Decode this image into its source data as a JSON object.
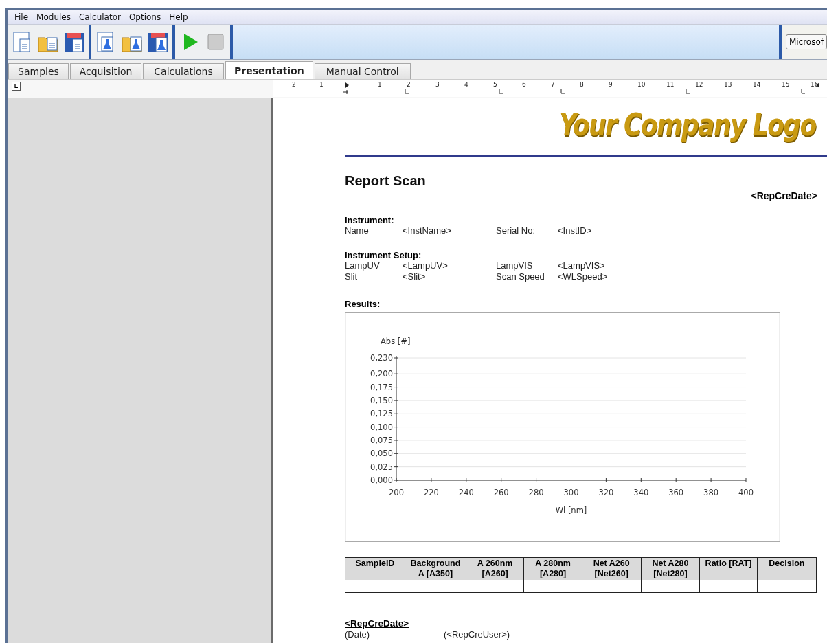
{
  "menu": [
    "File",
    "Modules",
    "Calculator",
    "Options",
    "Help"
  ],
  "toolbar": {
    "groups": [
      [
        {
          "kind": "doc"
        },
        {
          "kind": "folder-doc"
        },
        {
          "kind": "floppy-doc"
        }
      ],
      [
        {
          "kind": "flask-doc"
        },
        {
          "kind": "folder-flask"
        },
        {
          "kind": "floppy-flask"
        }
      ],
      [
        {
          "kind": "play"
        },
        {
          "kind": "stop"
        }
      ]
    ],
    "font_box": "Microsof"
  },
  "tabs": [
    {
      "label": "Samples",
      "selected": false
    },
    {
      "label": "Acquisition",
      "selected": false
    },
    {
      "label": "Calculations",
      "selected": false
    },
    {
      "label": "Presentation",
      "selected": true
    },
    {
      "label": "Manual Control",
      "selected": false
    }
  ],
  "ruler": {
    "corner": "L",
    "labels": [
      "2",
      "1",
      "1",
      "2",
      "3",
      "4",
      "5",
      "6",
      "7",
      "8",
      "9",
      "10",
      "11",
      "12",
      "13",
      "14",
      "15",
      "16"
    ]
  },
  "report": {
    "logo": "Your Company Logo",
    "title": "Report Scan",
    "date": "<RepCreDate>",
    "instrument": {
      "heading": "Instrument:",
      "fields": [
        {
          "label": "Name",
          "value": "<InstName>"
        },
        {
          "label": "Serial No:",
          "value": "<InstID>"
        }
      ]
    },
    "setup": {
      "heading": "Instrument Setup:",
      "fields": [
        {
          "label": "LampUV",
          "value": "<LampUV>"
        },
        {
          "label": "LampVIS",
          "value": "<LampVIS>"
        },
        {
          "label": "Slit",
          "value": "<Slit>"
        },
        {
          "label": "Scan Speed",
          "value": "<WLSpeed>"
        }
      ]
    },
    "results_heading": "Results:",
    "chart_data": {
      "type": "line",
      "grid": true,
      "xlabel": "Wl [nm]",
      "ylabel": "Abs [#]",
      "xlim": [
        200,
        400
      ],
      "ylim": [
        0,
        0.23
      ],
      "xticks": [
        200,
        220,
        240,
        260,
        280,
        300,
        320,
        340,
        360,
        380,
        400
      ],
      "yticks": [
        {
          "value": 0,
          "label": "0,000"
        },
        {
          "value": 0.025,
          "label": "0,025"
        },
        {
          "value": 0.05,
          "label": "0,050"
        },
        {
          "value": 0.075,
          "label": "0,075"
        },
        {
          "value": 0.1,
          "label": "0,100"
        },
        {
          "value": 0.125,
          "label": "0,125"
        },
        {
          "value": 0.15,
          "label": "0,150"
        },
        {
          "value": 0.175,
          "label": "0,175"
        },
        {
          "value": 0.2,
          "label": "0,200"
        },
        {
          "value": 0.23,
          "label": "0,230"
        }
      ]
    },
    "table": {
      "columns": [
        "SampleID",
        "Background A [A350]",
        "A 260nm [A260]",
        "A 280nm [A280]",
        "Net A260 [Net260]",
        "Net A280 [Net280]",
        "Ratio [RAT]",
        "Decision"
      ]
    },
    "signature": {
      "date": "<RepCreDate>",
      "date_caption": "(Date)",
      "user_caption": "(<RepCreUser>)"
    }
  }
}
